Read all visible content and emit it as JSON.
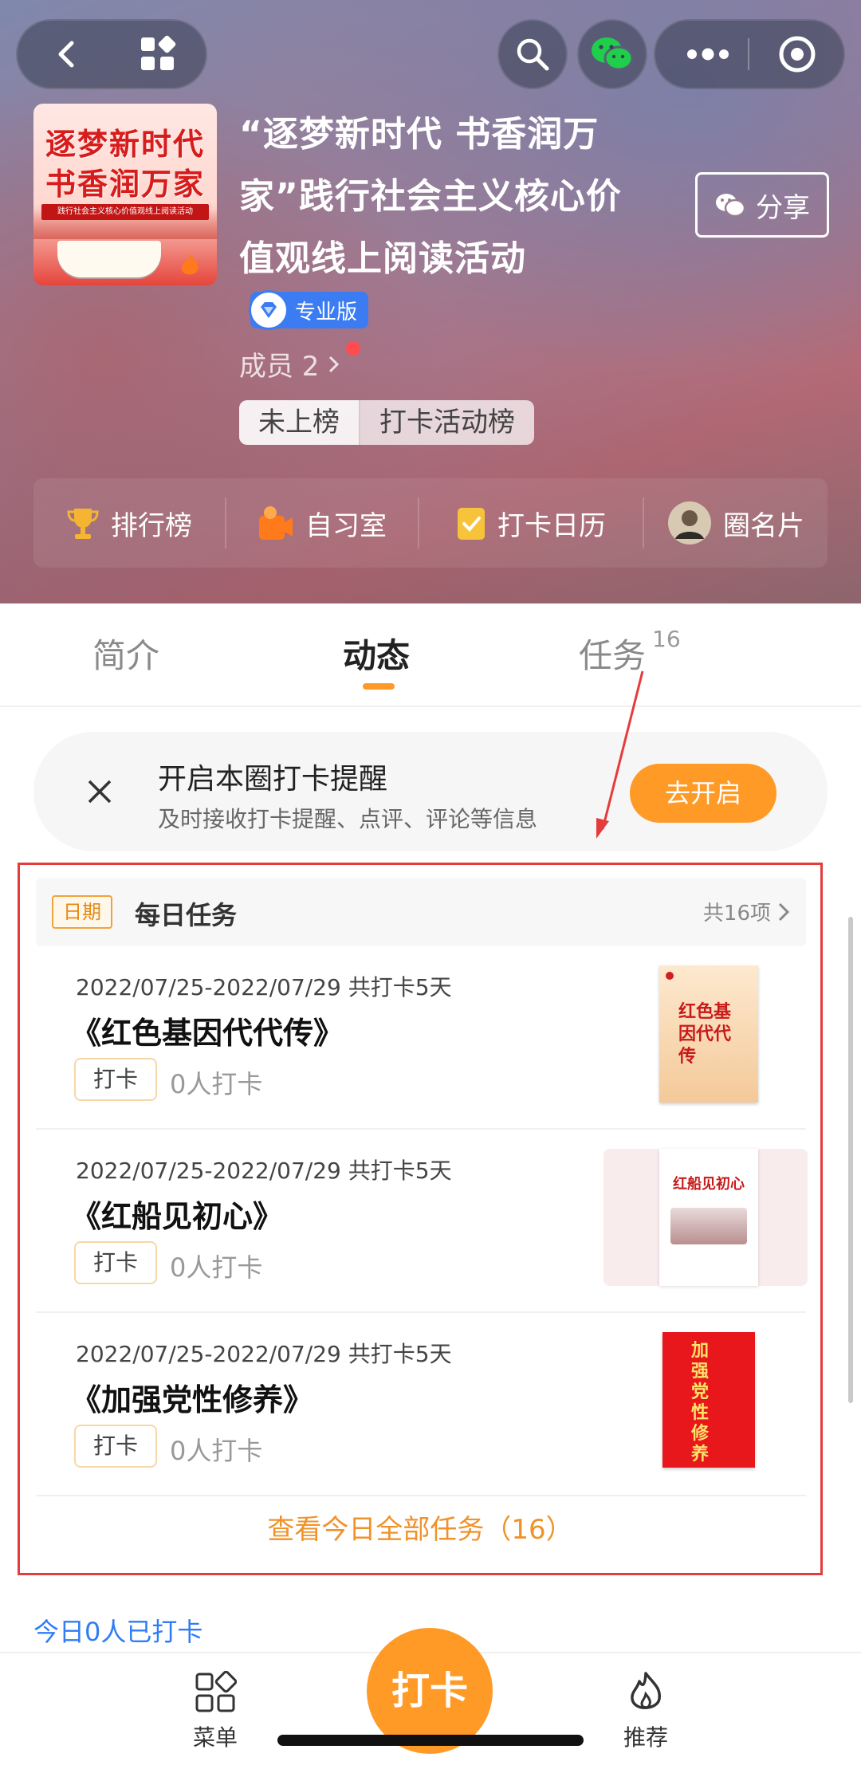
{
  "header": {
    "cover": {
      "line1": "逐梦新时代",
      "line2": "书香润万家",
      "subtitle": "践行社会主义核心价值观线上阅读活动"
    },
    "title_lines": [
      "“逐梦新时代 书香润万",
      "家”践行社会主义核心价",
      "值观线上阅读活动"
    ],
    "share_label": "分享",
    "edition_badge": "专业版",
    "members_label": "成员 2",
    "rank_status": "未上榜",
    "rank_board": "打卡活动榜",
    "quick_links": [
      {
        "label": "排行榜",
        "icon": "trophy-icon"
      },
      {
        "label": "自习室",
        "icon": "study-room-icon"
      },
      {
        "label": "打卡日历",
        "icon": "calendar-icon"
      },
      {
        "label": "圈名片",
        "icon": "avatar-icon"
      }
    ]
  },
  "tabs": [
    {
      "label": "简介",
      "active": false
    },
    {
      "label": "动态",
      "active": true
    },
    {
      "label": "任务",
      "active": false,
      "badge": "16"
    }
  ],
  "reminder": {
    "title": "开启本圈打卡提醒",
    "subtitle": "及时接收打卡提醒、点评、评论等信息",
    "button": "去开启"
  },
  "tasks": {
    "date_tag": "日期",
    "heading": "每日任务",
    "total": "共16项",
    "items": [
      {
        "dates": "2022/07/25-2022/07/29  共打卡5天",
        "name": "《红色基因代代传》",
        "action": "打卡",
        "count": "0人打卡",
        "book_text": "红色基因代代传"
      },
      {
        "dates": "2022/07/25-2022/07/29  共打卡5天",
        "name": "《红船见初心》",
        "action": "打卡",
        "count": "0人打卡",
        "book_text": "红船见初心"
      },
      {
        "dates": "2022/07/25-2022/07/29  共打卡5天",
        "name": "《加强党性修养》",
        "action": "打卡",
        "count": "0人打卡",
        "book_text": "加强党性修养"
      }
    ],
    "view_all": "查看今日全部任务（16）"
  },
  "today_status": "今日0人已打卡",
  "bottom_nav": {
    "menu": "菜单",
    "checkin": "打卡",
    "recommend": "推荐"
  },
  "colors": {
    "accent": "#ff9a27",
    "highlight_border": "#e43c3c",
    "link": "#2f7cf6",
    "badge_blue": "#3b7cf2"
  }
}
